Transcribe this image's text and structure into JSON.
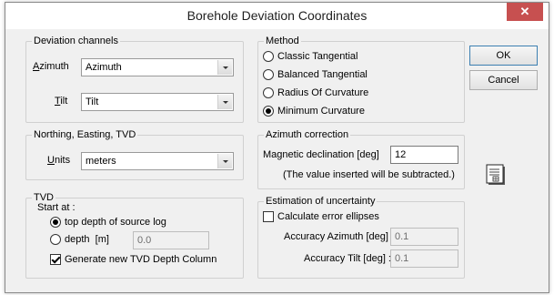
{
  "window": {
    "title": "Borehole Deviation Coordinates",
    "close_glyph": "✕"
  },
  "deviation_channels": {
    "legend": "Deviation channels",
    "azimuth": {
      "label": "Azimuth",
      "value": "Azimuth"
    },
    "tilt": {
      "label": "Tilt",
      "value": "Tilt"
    }
  },
  "nev": {
    "legend": "Northing, Easting, TVD",
    "units": {
      "label": "Units",
      "value": "meters"
    }
  },
  "tvd": {
    "legend": "TVD",
    "start_at": "Start at :",
    "options": [
      "top depth of source log",
      "depth  [m]"
    ],
    "selected": 0,
    "depth_value": "0.0",
    "generate": {
      "label": "Generate new TVD Depth Column",
      "checked": true
    }
  },
  "method": {
    "legend": "Method",
    "options": [
      "Classic Tangential",
      "Balanced Tangential",
      "Radius Of Curvature",
      "Minimum Curvature"
    ],
    "selected": 3
  },
  "azimuth_correction": {
    "legend": "Azimuth correction",
    "declination_label": "Magnetic declination [deg]",
    "declination_value": "12",
    "note": "(The value inserted will be subtracted.)"
  },
  "uncertainty": {
    "legend": "Estimation of uncertainty",
    "error_ellipses": {
      "label": "Calculate error ellipses",
      "checked": false
    },
    "accuracy_azimuth": {
      "label": "Accuracy Azimuth [deg] :",
      "value": "0.1"
    },
    "accuracy_tilt": {
      "label": "Accuracy Tilt [deg] :",
      "value": "0.1"
    }
  },
  "buttons": {
    "ok": "OK",
    "cancel": "Cancel"
  },
  "icons": {
    "report": "report-icon"
  }
}
